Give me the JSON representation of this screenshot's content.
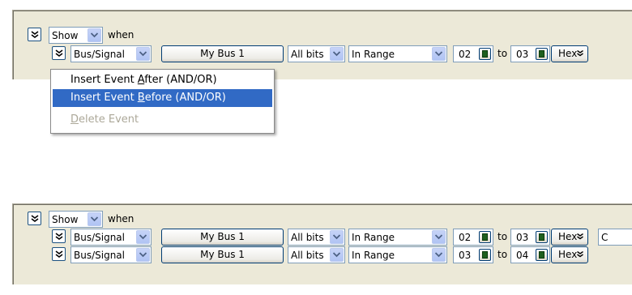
{
  "show_select": {
    "value": "Show"
  },
  "when_label": "when",
  "to_label": "to",
  "top_row": {
    "type_select": "Bus/Signal",
    "bus_button": "My Bus 1",
    "bits_select": "All bits",
    "range_select": "In Range",
    "from_value": "02",
    "to_value": "03",
    "radix_button": "Hex"
  },
  "context_menu": {
    "items": [
      {
        "pre": "Insert Event ",
        "u": "A",
        "post": "fter (AND/OR)",
        "state": "normal"
      },
      {
        "pre": "Insert Event ",
        "u": "B",
        "post": "efore (AND/OR)",
        "state": "selected"
      },
      {
        "pre": "",
        "u": "D",
        "post": "elete Event",
        "state": "disabled"
      }
    ]
  },
  "bottom_rows": [
    {
      "type_select": "Bus/Signal",
      "bus_button": "My Bus 1",
      "bits_select": "All bits",
      "range_select": "In Range",
      "from_value": "02",
      "to_value": "03",
      "radix_button": "Hex",
      "trailing_text": "C"
    },
    {
      "type_select": "Bus/Signal",
      "bus_button": "My Bus 1",
      "bits_select": "All bits",
      "range_select": "In Range",
      "from_value": "03",
      "to_value": "04",
      "radix_button": "Hex",
      "trailing_text": ""
    }
  ],
  "icons": {
    "chevron": "double-chevron-down-icon",
    "dropdown": "dropdown-arrow-icon",
    "calculator": "calculator-icon"
  }
}
